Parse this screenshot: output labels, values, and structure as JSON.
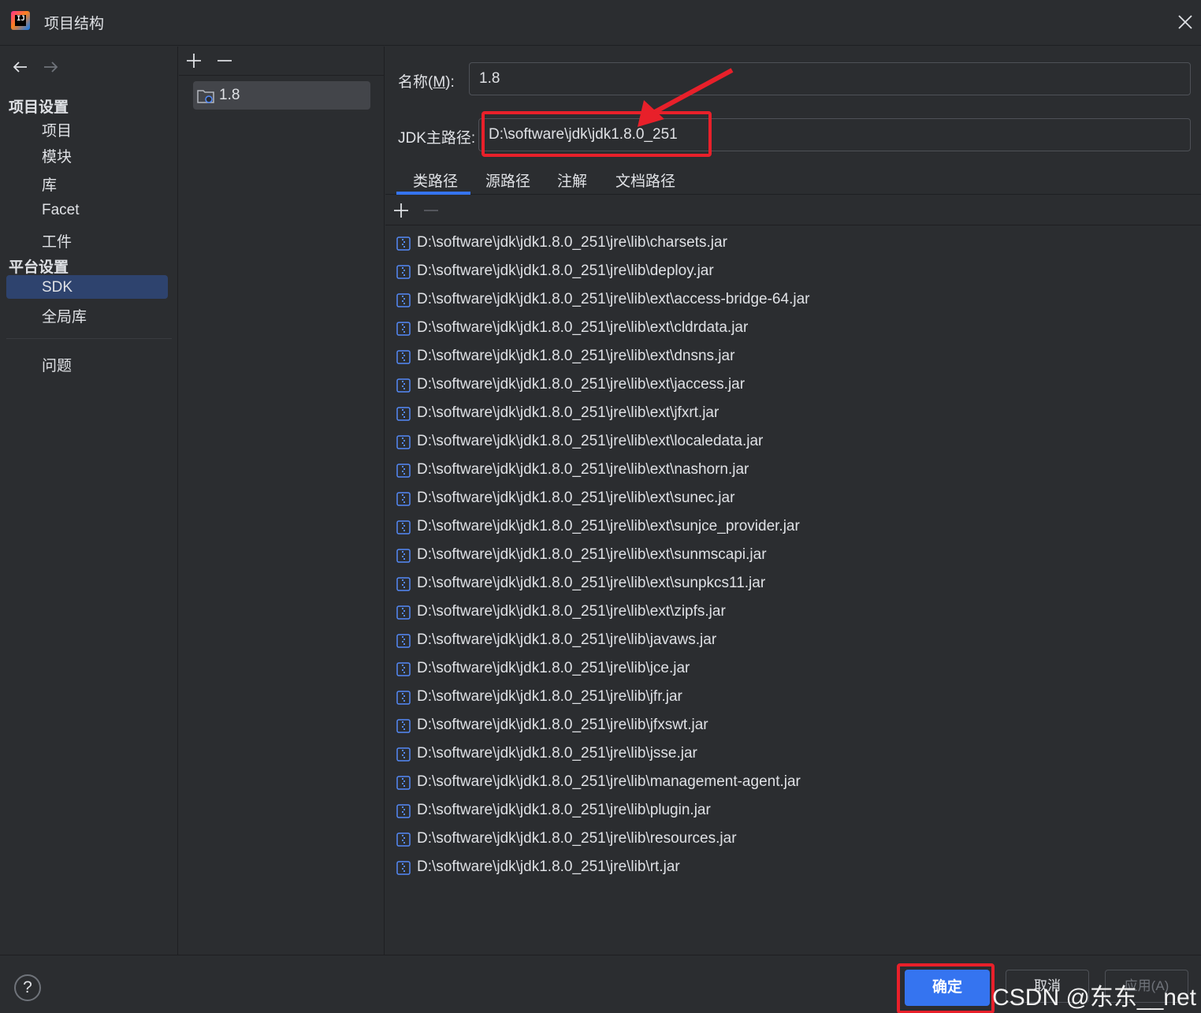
{
  "window": {
    "title": "项目结构",
    "logo_text": "IJ"
  },
  "nav": {
    "project_settings_header": "项目设置",
    "project_settings_items": [
      "项目",
      "模块",
      "库",
      "Facet",
      "工件"
    ],
    "platform_settings_header": "平台设置",
    "platform_settings_items": [
      "SDK",
      "全局库"
    ],
    "selected_item": "SDK",
    "problems_item": "问题"
  },
  "sdk_list": {
    "items": [
      "1.8"
    ]
  },
  "detail": {
    "name_label_prefix": "名称(",
    "name_label_mnemonic": "M",
    "name_label_suffix": "):",
    "name_value": "1.8",
    "jdk_home_label": "JDK主路径:",
    "jdk_home_value": "D:\\software\\jdk\\jdk1.8.0_251",
    "tabs": [
      "类路径",
      "源路径",
      "注解",
      "文档路径"
    ],
    "active_tab": "类路径",
    "classpath": [
      "D:\\software\\jdk\\jdk1.8.0_251\\jre\\lib\\charsets.jar",
      "D:\\software\\jdk\\jdk1.8.0_251\\jre\\lib\\deploy.jar",
      "D:\\software\\jdk\\jdk1.8.0_251\\jre\\lib\\ext\\access-bridge-64.jar",
      "D:\\software\\jdk\\jdk1.8.0_251\\jre\\lib\\ext\\cldrdata.jar",
      "D:\\software\\jdk\\jdk1.8.0_251\\jre\\lib\\ext\\dnsns.jar",
      "D:\\software\\jdk\\jdk1.8.0_251\\jre\\lib\\ext\\jaccess.jar",
      "D:\\software\\jdk\\jdk1.8.0_251\\jre\\lib\\ext\\jfxrt.jar",
      "D:\\software\\jdk\\jdk1.8.0_251\\jre\\lib\\ext\\localedata.jar",
      "D:\\software\\jdk\\jdk1.8.0_251\\jre\\lib\\ext\\nashorn.jar",
      "D:\\software\\jdk\\jdk1.8.0_251\\jre\\lib\\ext\\sunec.jar",
      "D:\\software\\jdk\\jdk1.8.0_251\\jre\\lib\\ext\\sunjce_provider.jar",
      "D:\\software\\jdk\\jdk1.8.0_251\\jre\\lib\\ext\\sunmscapi.jar",
      "D:\\software\\jdk\\jdk1.8.0_251\\jre\\lib\\ext\\sunpkcs11.jar",
      "D:\\software\\jdk\\jdk1.8.0_251\\jre\\lib\\ext\\zipfs.jar",
      "D:\\software\\jdk\\jdk1.8.0_251\\jre\\lib\\javaws.jar",
      "D:\\software\\jdk\\jdk1.8.0_251\\jre\\lib\\jce.jar",
      "D:\\software\\jdk\\jdk1.8.0_251\\jre\\lib\\jfr.jar",
      "D:\\software\\jdk\\jdk1.8.0_251\\jre\\lib\\jfxswt.jar",
      "D:\\software\\jdk\\jdk1.8.0_251\\jre\\lib\\jsse.jar",
      "D:\\software\\jdk\\jdk1.8.0_251\\jre\\lib\\management-agent.jar",
      "D:\\software\\jdk\\jdk1.8.0_251\\jre\\lib\\plugin.jar",
      "D:\\software\\jdk\\jdk1.8.0_251\\jre\\lib\\resources.jar",
      "D:\\software\\jdk\\jdk1.8.0_251\\jre\\lib\\rt.jar"
    ]
  },
  "footer": {
    "help_label": "?",
    "ok_label": "确定",
    "cancel_label": "取消",
    "apply_label": "应用(A)",
    "watermark": "CSDN @东东__net"
  },
  "colors": {
    "background": "#2b2d30",
    "selection": "#2e436e",
    "accent": "#3574f0",
    "annotation_red": "#e8202a"
  },
  "icons": {
    "back": "arrow-left-icon",
    "forward": "arrow-right-icon",
    "add": "plus-icon",
    "remove": "minus-icon",
    "close": "close-icon",
    "sdk": "sdk-folder-icon",
    "jar": "jar-archive-icon"
  }
}
